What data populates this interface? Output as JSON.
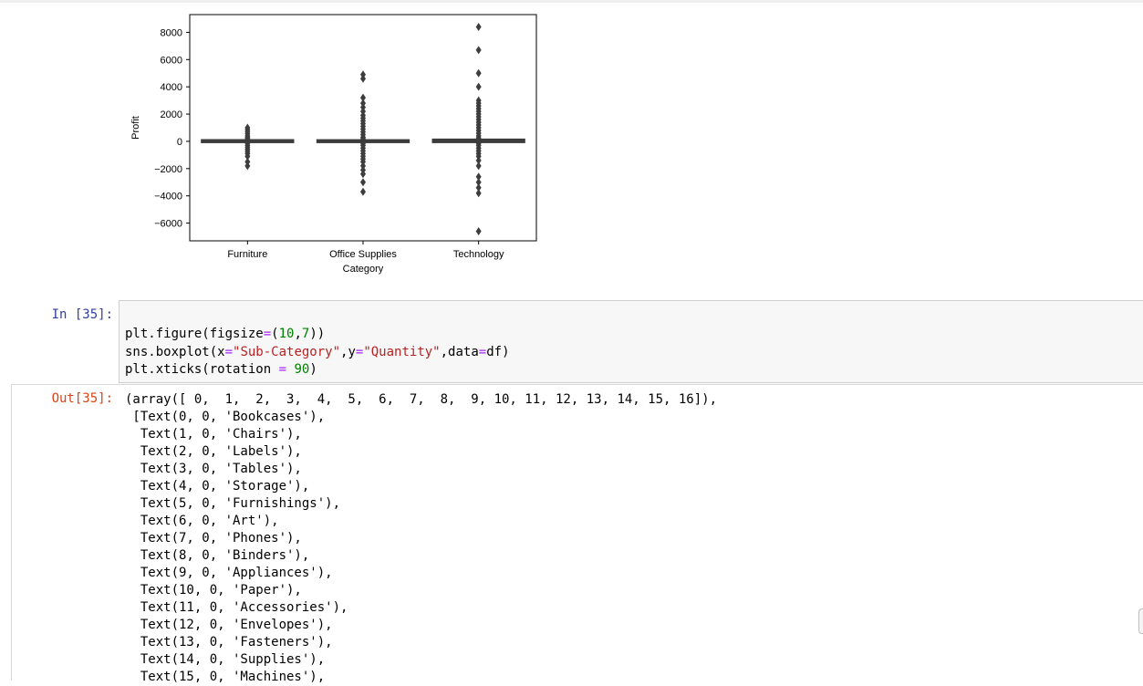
{
  "chart_data": {
    "type": "box",
    "xlabel": "Category",
    "ylabel": "Profit",
    "categories": [
      "Furniture",
      "Office Supplies",
      "Technology"
    ],
    "yticks": [
      8000,
      6000,
      4000,
      2000,
      0,
      -2000,
      -4000,
      -6000
    ],
    "ytick_labels": [
      "8000",
      "6000",
      "4000",
      "2000",
      "0",
      "−2000",
      "−4000",
      "−6000"
    ],
    "ylim": [
      -7300,
      9300
    ],
    "boxes": [
      {
        "category": "Furniture",
        "q1": 0,
        "median": 7,
        "q3": 30,
        "outliers": [
          1000,
          850,
          700,
          550,
          400,
          300,
          200,
          -150,
          -300,
          -450,
          -600,
          -750,
          -900,
          -1100,
          -1500,
          -1800
        ]
      },
      {
        "category": "Office Supplies",
        "q1": 1,
        "median": 6,
        "q3": 25,
        "outliers": [
          4900,
          4600,
          3200,
          2800,
          2500,
          2200,
          1900,
          1700,
          1500,
          1300,
          1100,
          900,
          700,
          500,
          300,
          200,
          -150,
          -300,
          -500,
          -700,
          -900,
          -1100,
          -1300,
          -1500,
          -1800,
          -2100,
          -2400,
          -3000,
          -3700
        ]
      },
      {
        "category": "Technology",
        "q1": 2,
        "median": 20,
        "q3": 70,
        "outliers": [
          8400,
          6700,
          5000,
          4000,
          3000,
          2800,
          2600,
          2400,
          2200,
          2000,
          1800,
          1600,
          1400,
          1200,
          1000,
          800,
          600,
          400,
          250,
          -150,
          -300,
          -500,
          -700,
          -900,
          -1100,
          -1400,
          -1800,
          -2600,
          -3000,
          -3400,
          -3800,
          -6600
        ]
      }
    ]
  },
  "input_cell": {
    "prompt": "In [35]:",
    "lines": [
      [
        {
          "t": "plt.figure(figsize"
        },
        {
          "t": "=",
          "c": "op"
        },
        {
          "t": "("
        },
        {
          "t": "10",
          "c": "num"
        },
        {
          "t": ","
        },
        {
          "t": "7",
          "c": "num"
        },
        {
          "t": "))"
        }
      ],
      [
        {
          "t": "sns.boxplot(x"
        },
        {
          "t": "=",
          "c": "op"
        },
        {
          "t": "\"Sub-Category\"",
          "c": "str"
        },
        {
          "t": ",y"
        },
        {
          "t": "=",
          "c": "op"
        },
        {
          "t": "\"Quantity\"",
          "c": "str"
        },
        {
          "t": ",data"
        },
        {
          "t": "=",
          "c": "op"
        },
        {
          "t": "df)"
        }
      ],
      [
        {
          "t": "plt.xticks(rotation "
        },
        {
          "t": "=",
          "c": "op"
        },
        {
          "t": " "
        },
        {
          "t": "90",
          "c": "num"
        },
        {
          "t": ")"
        }
      ]
    ]
  },
  "output_cell": {
    "prompt": "Out[35]:",
    "lines": [
      "(array([ 0,  1,  2,  3,  4,  5,  6,  7,  8,  9, 10, 11, 12, 13, 14, 15, 16]),",
      " [Text(0, 0, 'Bookcases'),",
      "  Text(1, 0, 'Chairs'),",
      "  Text(2, 0, 'Labels'),",
      "  Text(3, 0, 'Tables'),",
      "  Text(4, 0, 'Storage'),",
      "  Text(5, 0, 'Furnishings'),",
      "  Text(6, 0, 'Art'),",
      "  Text(7, 0, 'Phones'),",
      "  Text(8, 0, 'Binders'),",
      "  Text(9, 0, 'Appliances'),",
      "  Text(10, 0, 'Paper'),",
      "  Text(11, 0, 'Accessories'),",
      "  Text(12, 0, 'Envelopes'),",
      "  Text(13, 0, 'Fasteners'),",
      "  Text(14, 0, 'Supplies'),",
      "  Text(15, 0, 'Machines'),"
    ]
  }
}
